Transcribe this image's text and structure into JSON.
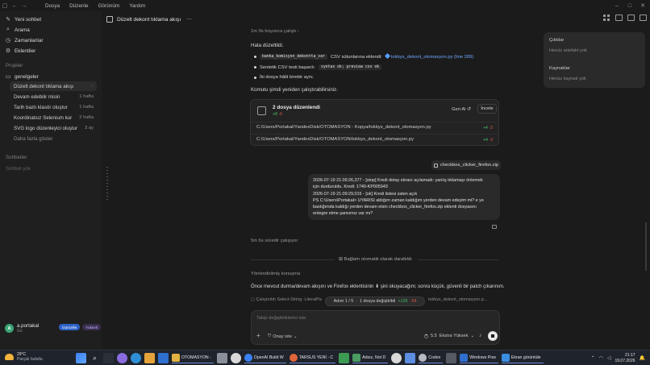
{
  "menu": [
    "Dosya",
    "Düzenle",
    "Görünüm",
    "Yardım"
  ],
  "sidebar": {
    "nav": [
      {
        "label": "Yeni sohbet",
        "icon": "new-chat-icon"
      },
      {
        "label": "Arama",
        "icon": "search-icon"
      },
      {
        "label": "Zamanlanlar",
        "icon": "clock-icon"
      },
      {
        "label": "Eklentiler",
        "icon": "plugin-icon"
      }
    ],
    "projects_label": "Projeler",
    "project_name": "genelgeler",
    "threads": [
      {
        "title": "Düzelt dekont tıklama akışı",
        "age": "",
        "active": true
      },
      {
        "title": "Devam edebilir misin",
        "age": "1 hafta"
      },
      {
        "title": "Tarih bazlı klasör oluştur",
        "age": "1 hafta"
      },
      {
        "title": "Koordinatsız Selenium kur",
        "age": "2 hafta"
      },
      {
        "title": "SVG logo düzenleyici oluştur",
        "age": "3 ay"
      }
    ],
    "show_more": "Daha fazla göster",
    "chats_label": "Sohbetler",
    "chats_empty": "Sohbet yok",
    "user": {
      "initials": "A",
      "name": "a.portakal",
      "sub": "Go",
      "update_label": "Güncelle",
      "badge_label": "Yükselt"
    }
  },
  "header": {
    "title": "Düzelt dekont tıklama akışı",
    "more": "⋯"
  },
  "right_panel": {
    "outputs_title": "Çıktılar",
    "outputs_empty": "Henüz artefakt yok",
    "sources_title": "Kaynaklar",
    "sources_empty": "Henüz kaynak yok"
  },
  "conversation": {
    "worked_for": "1m 9s boyunca çalıştı",
    "fixed_heading": "Hata düzeltildi.",
    "bullet1_code": "banka_komisyon_dekontta_var",
    "bullet1_text": " CSV sütunlarına eklendi: ",
    "bullet1_link": "tokbys_dekont_otomasyon.py (line 289)",
    "bullet2_text": "Sentetik CSV testi başarılı: ",
    "bullet2_code": "syntax ok; preview csv ok",
    "bullet3_text": "İki dosya hâlâ birebir aynı.",
    "run_again": "Komutu şimdi yeniden çalıştırabilirsiniz.",
    "card": {
      "title": "2 dosya düzenlendi",
      "added": "+8",
      "removed": "-6",
      "undo_label": "Geri Al ↺",
      "review_label": "İncele",
      "files": [
        {
          "path": "C:/Users/Portakal/YandexDisk/OTOMASYON - Kopya/tokbys_dekont_otomasyon.py",
          "added": "+4",
          "removed": "-3"
        },
        {
          "path": "C:/Users/Portakal/YandexDisk/OTOMASYON/tokbys_dekont_otomasyon.py",
          "added": "+4",
          "removed": "-3"
        }
      ]
    },
    "attachment": "checkbox_clicker_firefox.zip",
    "user_message_lines": [
      "2026-07-19 21:09:26,377 - [stop] Kredi detay ekranı açılamadı: yanlış tıklamayı önlemek",
      "için durduruldu. Kredi: 1740-KP005943",
      "2026-07-19 21:09:29,015 - [ok] Kredi listesi zaten açık",
      "PS C:\\Users\\Portakal>    UYARISI aldığım zaman kaldığım yerden devam edeyim mi? e ye",
      "bastığımda kaldığı yerden devam etsin checkbox_clicker_firefox.zip eklenti dosyasını",
      "entegre etme şansımız var mı?"
    ],
    "thought_for": "5m 6s süredir çalışıyor",
    "context_note": "Bağlam otomatik olarak daraltıldı",
    "redirect_label": "Yönlendirilmiş konuşma",
    "para_text": "Önce mevcut durma/devam akışını ve Firefox eklentisinin  ⬇  şini okuyacağım; sonra küçük, güvenli bir patch çıkarınım.",
    "ran_text": "Çalıştırıldı Select-String -LiteralPa",
    "ran_text2": "tokbys_dekont_otomasyon.p...",
    "step_label": "Adım 1 / 5",
    "step_sep": " · ",
    "step_files": "1 dosya değiştirildi",
    "step_added": "+126",
    "step_removed": "-24"
  },
  "composer": {
    "placeholder": "Takip değişikliklerini iste",
    "permission": "Onay iste",
    "model": "5.5",
    "effort": "Ekstra Yüksek"
  },
  "taskbar": {
    "temp": "29°C",
    "weather": "Parçalı bulutlu",
    "apps": [
      {
        "label": "OTOMASYON -",
        "color": "#e2b340"
      },
      {
        "label": "OpenAI Build W",
        "color": "#3b82f6"
      },
      {
        "label": "TARSUS YENİ - C",
        "color": "#e0663a"
      },
      {
        "label": "Adsız, Not D",
        "color": "#4a9b62"
      },
      {
        "label": "Codex",
        "color": "#b8b8c0"
      },
      {
        "label": "Windows Pow",
        "color": "#2f6fcf"
      },
      {
        "label": "Ekran görüntüle",
        "color": "#3a8de0"
      }
    ],
    "time": "21:17",
    "date": "19.07.2026"
  },
  "colors": {
    "accent": "#2f63c9",
    "added": "#48c26b",
    "removed": "#e0584d",
    "link": "#6ea6ff"
  }
}
